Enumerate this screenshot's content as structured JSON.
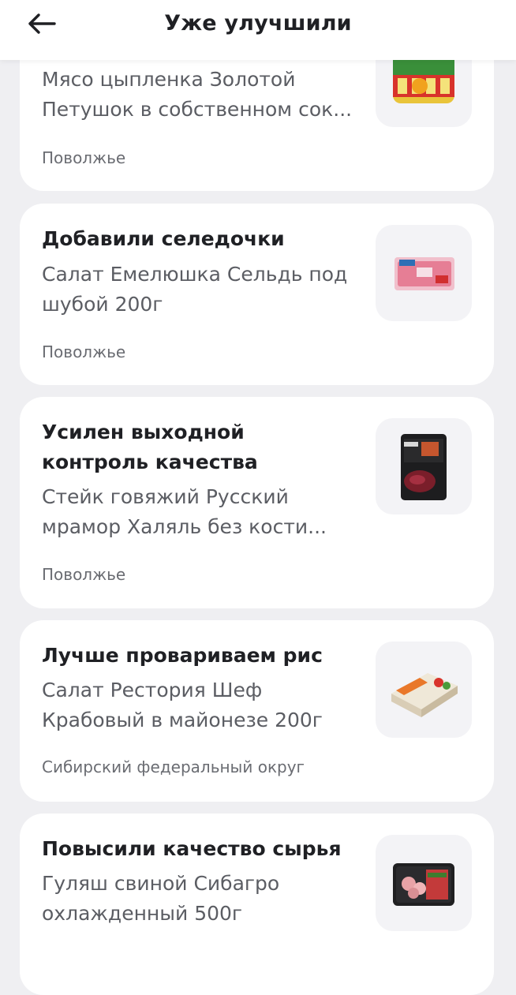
{
  "header": {
    "title": "Уже улучшили",
    "back_icon": "arrow-left-icon"
  },
  "cards": [
    {
      "title": "",
      "product_line1": "Мясо цыпленка Золотой",
      "product_line2": "Петушок в собственном сок...",
      "region": "Поволжье",
      "image": "canned-chicken-image"
    },
    {
      "title": "Добавили селедочки",
      "product_line1": "Салат Емелюшка Сельдь под",
      "product_line2": "шубой 200г",
      "region": "Поволжье",
      "image": "herring-salad-image"
    },
    {
      "title_line1": "Усилен выходной",
      "title_line2": "контроль качества",
      "product_line1": "Стейк говяжий Русский",
      "product_line2": "мрамор Халяль без кости...",
      "region": "Поволжье",
      "image": "beef-steak-image"
    },
    {
      "title": "Лучше провариваем рис",
      "product_line1": "Салат Рестория Шеф",
      "product_line2": "Крабовый в майонезе 200г",
      "region": "Сибирский федеральный округ",
      "image": "crab-salad-image"
    },
    {
      "title": "Повысили качество сырья",
      "product_line1": "Гуляш свиной Сибагро",
      "product_line2": "охлажденный 500г",
      "region": "",
      "image": "pork-goulash-image"
    }
  ]
}
